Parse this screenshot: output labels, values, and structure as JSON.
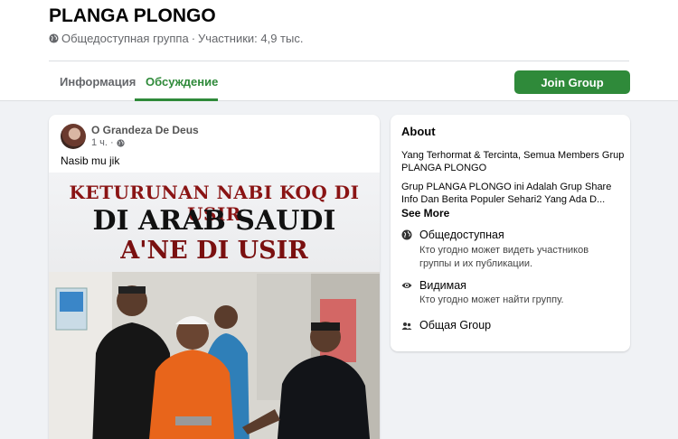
{
  "header": {
    "group_name": "PLANGA PLONGO",
    "privacy": "Общедоступная группа",
    "separator": "·",
    "members": "Участники: 4,9 тыс."
  },
  "tabs": [
    {
      "label": "Информация",
      "active": false
    },
    {
      "label": "Обсуждение",
      "active": true
    }
  ],
  "join_button": "Join Group",
  "post": {
    "author": "O Grandeza De Deus",
    "time": "1 ч.",
    "separator": "·",
    "text": "Nasib mu jik",
    "image_text": {
      "line1": "KETURUNAN NABI KOQ DI USIR",
      "line2": "DI ARAB SAUDI",
      "line3": "A'NE DI USIR"
    }
  },
  "about": {
    "title": "About",
    "desc_lines": [
      "Yang Terhormat & Tercinta, Semua Members Grup",
      "PLANGA PLONGO",
      "Grup PLANGA PLONGO ini Adalah Grup Share",
      "Info Dan Berita Populer Sehari2 Yang Ada D..."
    ],
    "see_more": "See More",
    "items": [
      {
        "icon": "globe-icon",
        "title": "Общедоступная",
        "desc": [
          "Кто угодно может видеть участников",
          "группы и их публикации."
        ]
      },
      {
        "icon": "eye-icon",
        "title": "Видимая",
        "desc": [
          "Кто угодно может найти группу."
        ]
      },
      {
        "icon": "people-icon",
        "title": "Общая Group",
        "desc": []
      }
    ]
  },
  "colors": {
    "accent_green": "#2f8a3a",
    "page_bg": "#f0f2f5",
    "muted_text": "#65676b"
  }
}
